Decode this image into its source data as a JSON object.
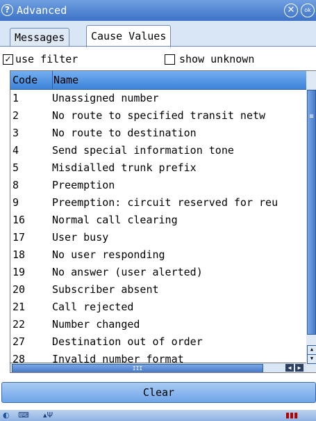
{
  "window": {
    "title": "Advanced"
  },
  "tabs": [
    {
      "label": "Messages",
      "active": false
    },
    {
      "label": "Cause Values",
      "active": true
    }
  ],
  "filters": {
    "use_filter": {
      "label": "use filter",
      "checked": true
    },
    "show_unknown": {
      "label": "show unknown",
      "checked": false
    }
  },
  "table": {
    "columns": [
      "Code",
      "Name"
    ],
    "rows": [
      {
        "code": "1",
        "name": "Unassigned number"
      },
      {
        "code": "2",
        "name": "No route to specified transit netw"
      },
      {
        "code": "3",
        "name": "No route to destination"
      },
      {
        "code": "4",
        "name": "Send special information tone"
      },
      {
        "code": "5",
        "name": "Misdialled trunk prefix"
      },
      {
        "code": "8",
        "name": "Preemption"
      },
      {
        "code": "9",
        "name": "Preemption: circuit reserved for reu"
      },
      {
        "code": "16",
        "name": "Normal call clearing"
      },
      {
        "code": "17",
        "name": "User busy"
      },
      {
        "code": "18",
        "name": "No user responding"
      },
      {
        "code": "19",
        "name": "No answer (user alerted)"
      },
      {
        "code": "20",
        "name": "Subscriber absent"
      },
      {
        "code": "21",
        "name": "Call rejected"
      },
      {
        "code": "22",
        "name": "Number changed"
      },
      {
        "code": "27",
        "name": "Destination out of order"
      },
      {
        "code": "28",
        "name": "Invalid number format"
      }
    ]
  },
  "actions": {
    "clear_label": "Clear"
  },
  "icons": {
    "help": "help-icon",
    "close": "close-icon",
    "ok": "ok-icon",
    "start": "start-icon",
    "keyboard": "keyboard-icon",
    "antenna": "antenna-icon",
    "signal": "signal-icon"
  },
  "colors": {
    "title_bar": "#3d72c6",
    "table_header": "#4f93e3",
    "button": "#8bb8ee"
  }
}
